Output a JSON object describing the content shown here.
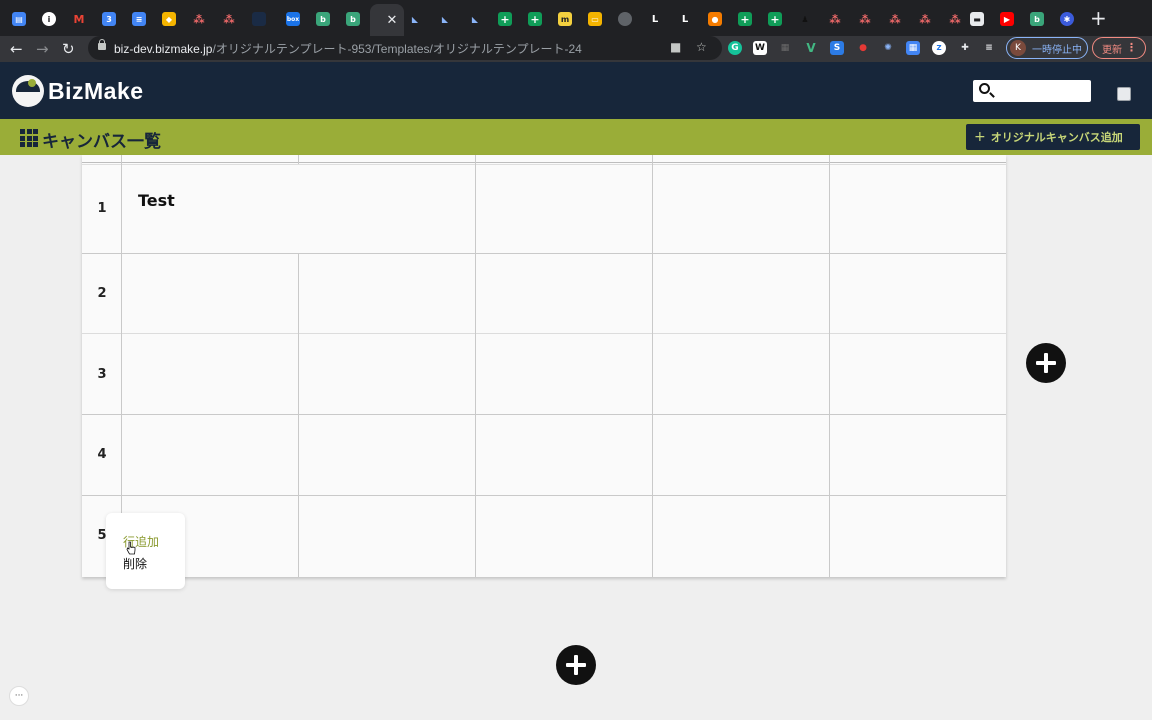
{
  "browser": {
    "url_host": "biz-dev.bizmake.jp",
    "url_path": "/オリジナルテンプレート-953/Templates/オリジナルテンプレート-24",
    "profile_initial": "K",
    "profile_status": "一時停止中",
    "update_label": "更新",
    "tab_close": "✕",
    "new_tab": "+",
    "colors": {
      "tabstrip": "#202124",
      "toolbar": "#35363a"
    }
  },
  "app": {
    "logo_text": "BizMake",
    "title": "キャンバス一覧",
    "add_button_label": "オリジナルキャンバス追加",
    "add_button_icon": "+",
    "search": {
      "placeholder": ""
    },
    "colors": {
      "header": "#17263a",
      "accent": "#9aad38"
    }
  },
  "canvas": {
    "rows": [
      {
        "number": "1",
        "cells": [
          "Test",
          "",
          "",
          ""
        ]
      },
      {
        "number": "2",
        "cells": [
          "",
          "",
          "",
          "",
          ""
        ]
      },
      {
        "number": "3",
        "cells": [
          "",
          "",
          "",
          "",
          ""
        ]
      },
      {
        "number": "4",
        "cells": [
          "",
          "",
          "",
          "",
          ""
        ]
      },
      {
        "number": "5",
        "cells": [
          "",
          "",
          "",
          "",
          ""
        ]
      }
    ]
  },
  "context_menu": {
    "items": [
      {
        "label": "行追加",
        "state": "hover"
      },
      {
        "label": "削除",
        "state": "normal"
      }
    ]
  },
  "chat_icon": "···"
}
